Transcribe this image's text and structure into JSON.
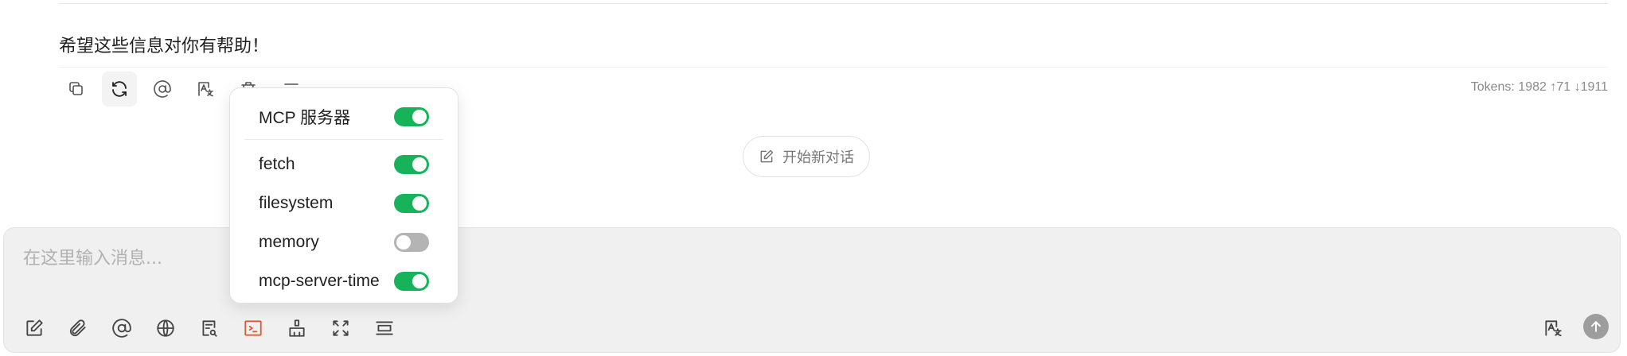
{
  "message": {
    "text": "希望这些信息对你有帮助！"
  },
  "message_actions": [
    {
      "name": "copy-button",
      "icon": "copy-icon"
    },
    {
      "name": "regenerate-button",
      "icon": "refresh-icon"
    },
    {
      "name": "mention-button",
      "icon": "at-icon"
    },
    {
      "name": "translate-button",
      "icon": "translate-icon"
    },
    {
      "name": "delete-button",
      "icon": "trash-icon"
    },
    {
      "name": "more-button",
      "icon": "more-icon"
    }
  ],
  "tokens": {
    "text": "Tokens: 1982 ↑71 ↓1911"
  },
  "new_chat": {
    "label": "开始新对话"
  },
  "input": {
    "placeholder": "在这里输入消息..."
  },
  "mcp_popup": {
    "header": {
      "label": "MCP 服务器",
      "enabled": true
    },
    "servers": [
      {
        "label": "fetch",
        "enabled": true
      },
      {
        "label": "filesystem",
        "enabled": true
      },
      {
        "label": "memory",
        "enabled": false
      },
      {
        "label": "mcp-server-time",
        "enabled": true
      }
    ]
  },
  "colors": {
    "toggle_on": "#16b35b",
    "toggle_off": "#b4b4b4",
    "active_tool": "#e05a3a",
    "send_button": "#9d9d9d"
  }
}
